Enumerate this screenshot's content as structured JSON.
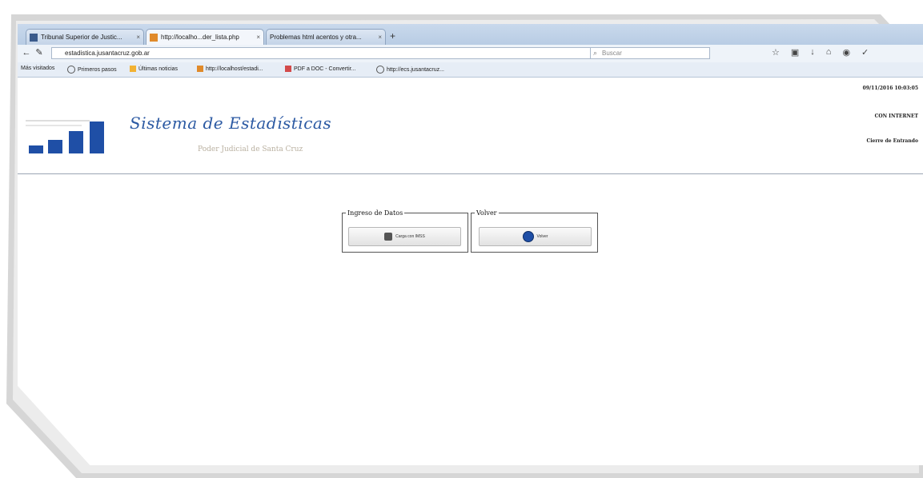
{
  "browser": {
    "tabs": [
      {
        "label": "Tribunal Superior de Justic..."
      },
      {
        "label": "http://localho...der_lista.php"
      },
      {
        "label": "Problemas html acentos y otra..."
      }
    ],
    "new_tab": "+",
    "url": "estadistica.jusantacruz.gob.ar",
    "search_placeholder": "Buscar",
    "bookmarks": [
      {
        "label": "Más visitados"
      },
      {
        "label": "Primeros pasos"
      },
      {
        "label": "Últimas noticias"
      },
      {
        "label": "http://localhost/estadi..."
      },
      {
        "label": "PDF a DOC - Convertir..."
      },
      {
        "label": "http://ecs.jusantacruz..."
      }
    ]
  },
  "header": {
    "title": "Sistema de Estadísticas",
    "subtitle": "Poder Judicial de Santa Cruz",
    "datetime": "09/11/2016 10:03:05",
    "user": "CON INTERNET",
    "logout": "Cierre de Entrando"
  },
  "ingresos": {
    "legend": "Ingreso de Datos",
    "button": "Carga con IMSS"
  },
  "volver": {
    "legend": "Volver",
    "button": "Volver"
  },
  "colors": {
    "accent": "#1f4fa6",
    "title": "#2c5aa3"
  }
}
